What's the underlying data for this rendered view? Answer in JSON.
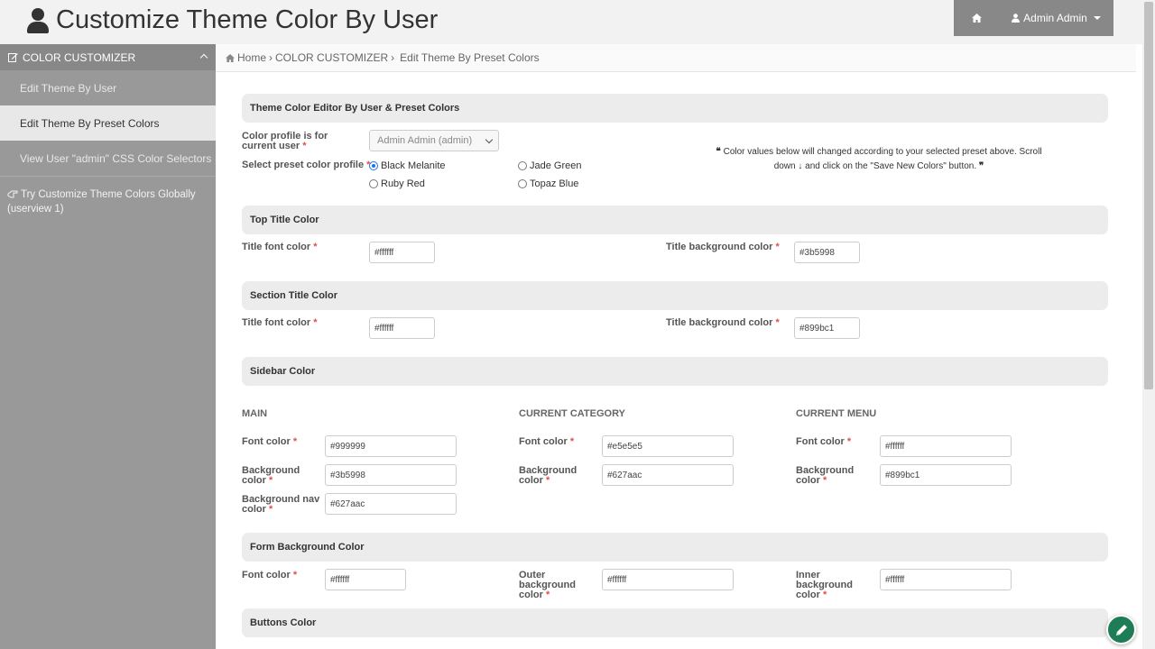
{
  "header": {
    "title": "Customize Theme Color By User",
    "admin_label": "Admin Admin"
  },
  "sidebar": {
    "section": "COLOR CUSTOMIZER",
    "items": [
      {
        "label": "Edit Theme By User"
      },
      {
        "label": "Edit Theme By Preset Colors"
      },
      {
        "label": "View User \"admin\" CSS Color Selectors"
      }
    ],
    "global_link": "Try Customize Theme Colors Globally (userview 1)"
  },
  "breadcrumb": {
    "home": "Home",
    "section": "COLOR CUSTOMIZER",
    "current": "Edit Theme By Preset Colors"
  },
  "editor": {
    "heading": "Theme Color Editor By User & Preset Colors",
    "profile_label": "Color profile is for current user",
    "profile_value": "Admin Admin (admin)",
    "preset_label": "Select preset color profile",
    "presets": [
      {
        "label": "Black Melanite",
        "checked": true
      },
      {
        "label": "Jade Green",
        "checked": false
      },
      {
        "label": "Ruby Red",
        "checked": false
      },
      {
        "label": "Topaz Blue",
        "checked": false
      }
    ],
    "note_part1": "Color values below will changed according to your selected preset above.   Scroll",
    "note_part2_a": "down",
    "note_part2_b": "and click on the \"Save New Colors\" button."
  },
  "top_title": {
    "heading": "Top Title Color",
    "font_label": "Title font color",
    "font_value": "#ffffff",
    "bg_label": "Title background color",
    "bg_value": "#3b5998"
  },
  "section_title": {
    "heading": "Section Title Color",
    "font_label": "Title font color",
    "font_value": "#ffffff",
    "bg_label": "Title background color",
    "bg_value": "#899bc1"
  },
  "sidebar_color": {
    "heading": "Sidebar Color",
    "main": {
      "title": "MAIN",
      "font_label": "Font color",
      "font_value": "#999999",
      "bg_label": "Background color",
      "bg_value": "#3b5998",
      "nav_label": "Background nav color",
      "nav_value": "#627aac"
    },
    "category": {
      "title": "CURRENT CATEGORY",
      "font_label": "Font color",
      "font_value": "#e5e5e5",
      "bg_label": "Background color",
      "bg_value": "#627aac"
    },
    "menu": {
      "title": "CURRENT MENU",
      "font_label": "Font color",
      "font_value": "#ffffff",
      "bg_label": "Background color",
      "bg_value": "#899bc1"
    }
  },
  "form_bg": {
    "heading": "Form Background Color",
    "font_label": "Font color",
    "font_value": "#ffffff",
    "outer_label": "Outer background color",
    "outer_value": "#ffffff",
    "inner_label": "Inner background color",
    "inner_value": "#ffffff"
  },
  "buttons": {
    "heading": "Buttons Color"
  }
}
